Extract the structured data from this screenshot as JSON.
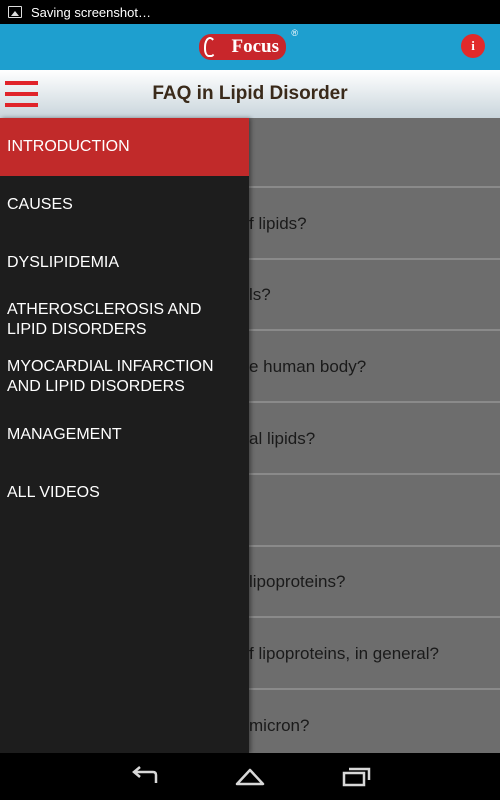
{
  "status_bar": {
    "text": "Saving screenshot…",
    "icon": "image-notification-icon"
  },
  "header": {
    "logo_text": "Focus",
    "logo_mark": "®",
    "info_label": "i",
    "brand_color": "#1e9fcf",
    "accent_color": "#c8262b"
  },
  "title_bar": {
    "title": "FAQ in Lipid Disorder",
    "menu_icon": "hamburger-menu-icon"
  },
  "drawer": {
    "items": [
      {
        "label": "INTRODUCTION",
        "active": true
      },
      {
        "label": "CAUSES"
      },
      {
        "label": "DYSLIPIDEMIA"
      },
      {
        "label": "ATHEROSCLEROSIS AND LIPID DISORDERS"
      },
      {
        "label": "MYOCARDIAL INFARCTION AND LIPID DISORDERS"
      },
      {
        "label": "MANAGEMENT"
      },
      {
        "label": "ALL VIDEOS"
      }
    ]
  },
  "faq_list": {
    "rows": [
      {
        "visible_text": ""
      },
      {
        "visible_text": "f lipids?"
      },
      {
        "visible_text": "ls?"
      },
      {
        "visible_text": "e human body?"
      },
      {
        "visible_text": "al lipids?"
      },
      {
        "visible_text": ""
      },
      {
        "visible_text": "lipoproteins?"
      },
      {
        "visible_text": "f lipoproteins, in general?"
      },
      {
        "visible_text": "micron?"
      }
    ]
  },
  "nav_bar": {
    "back_icon": "back-icon",
    "home_icon": "home-icon",
    "recents_icon": "recent-apps-icon"
  }
}
